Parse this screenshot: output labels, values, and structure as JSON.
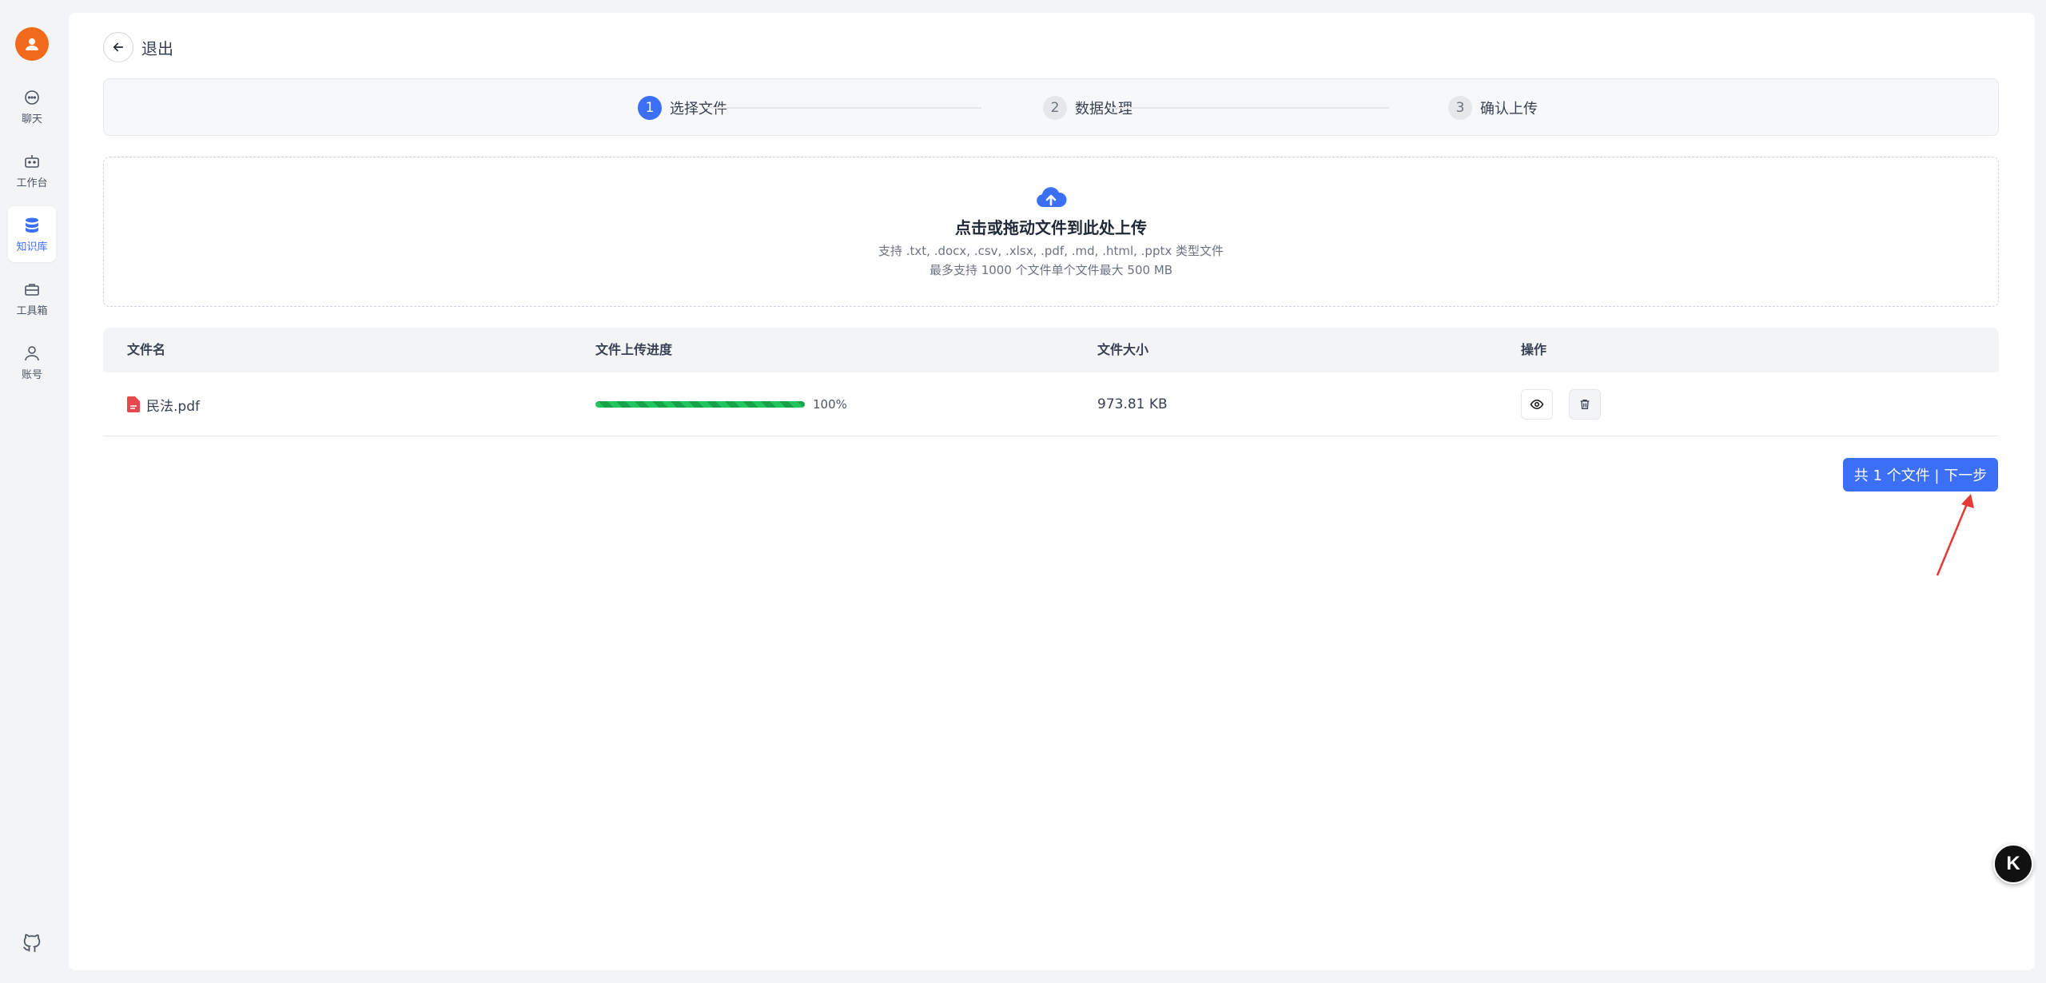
{
  "sidebar": {
    "items": [
      {
        "label": "聊天",
        "icon": "chat-icon"
      },
      {
        "label": "工作台",
        "icon": "robot-icon"
      },
      {
        "label": "知识库",
        "icon": "database-icon"
      },
      {
        "label": "工具箱",
        "icon": "toolbox-icon"
      },
      {
        "label": "账号",
        "icon": "user-icon"
      }
    ],
    "active_index": 2
  },
  "header": {
    "back_label": "退出"
  },
  "steps": [
    {
      "num": "1",
      "label": "选择文件"
    },
    {
      "num": "2",
      "label": "数据处理"
    },
    {
      "num": "3",
      "label": "确认上传"
    }
  ],
  "dropzone": {
    "title": "点击或拖动文件到此处上传",
    "hint1": "支持 .txt, .docx, .csv, .xlsx, .pdf, .md, .html, .pptx 类型文件",
    "hint2": "最多支持 1000 个文件单个文件最大 500 MB"
  },
  "table": {
    "headers": [
      "文件名",
      "文件上传进度",
      "文件大小",
      "操作"
    ],
    "rows": [
      {
        "name": "民法.pdf",
        "progress": 100,
        "progress_label": "100%",
        "size": "973.81 KB"
      }
    ]
  },
  "next_button": "共 1 个文件 | 下一步",
  "floating_badge": "K",
  "colors": {
    "accent": "#3b6ff5",
    "progress": "#22c55e",
    "avatar": "#f26b1d",
    "pdf": "#e5484d",
    "annotation": "#e53935"
  }
}
